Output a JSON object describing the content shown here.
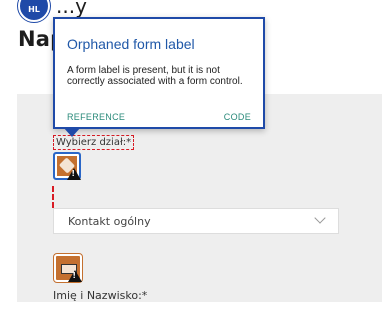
{
  "badge": {
    "text": "HL"
  },
  "header": {
    "top_text": "...y",
    "heading": "Nap"
  },
  "tooltip": {
    "title": "Orphaned form label",
    "body": "A form label is present, but it is not correctly associated with a form control.",
    "reference_label": "REFERENCE",
    "code_label": "CODE"
  },
  "form": {
    "department_label": "Wybierz dział:*",
    "select_value": "Kontakt ogólny",
    "name_label": "Imię i Nazwisko:*"
  },
  "icons": {
    "marker_1": "orphaned-label-warning-icon",
    "marker_2": "input-warning-icon"
  },
  "colors": {
    "accent": "#1f4aa8",
    "error": "#d81b24",
    "marker": "#c4702f",
    "link": "#2a8a7a"
  }
}
